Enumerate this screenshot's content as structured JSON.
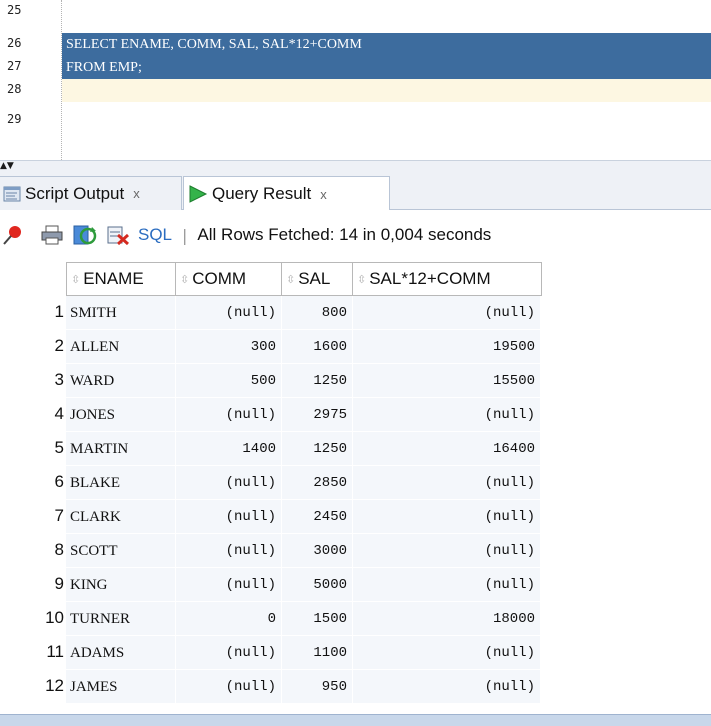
{
  "editor": {
    "lines": [
      {
        "num": "25",
        "code": "",
        "state": "normal"
      },
      {
        "num": "26",
        "code": "SELECT ENAME, COMM, SAL, SAL*12+COMM",
        "state": "selected"
      },
      {
        "num": "27",
        "code": "FROM EMP;",
        "state": "selected"
      },
      {
        "num": "28",
        "code": "",
        "state": "current"
      },
      {
        "num": "29",
        "code": "",
        "state": "normal"
      }
    ]
  },
  "tabs": {
    "script_output": {
      "label": "Script Output",
      "close": "x"
    },
    "query_result": {
      "label": "Query Result",
      "close": "x"
    }
  },
  "toolbar": {
    "icons": [
      "pin-icon",
      "print-icon",
      "refresh-icon",
      "sql-icon"
    ],
    "sql_label": "SQL",
    "separator": "|",
    "status": "All Rows Fetched: 14 in 0,004 seconds"
  },
  "grid": {
    "columns": [
      "ENAME",
      "COMM",
      "SAL",
      "SAL*12+COMM"
    ],
    "rows": [
      [
        "1",
        "SMITH",
        "(null)",
        "800",
        "(null)"
      ],
      [
        "2",
        "ALLEN",
        "300",
        "1600",
        "19500"
      ],
      [
        "3",
        "WARD",
        "500",
        "1250",
        "15500"
      ],
      [
        "4",
        "JONES",
        "(null)",
        "2975",
        "(null)"
      ],
      [
        "5",
        "MARTIN",
        "1400",
        "1250",
        "16400"
      ],
      [
        "6",
        "BLAKE",
        "(null)",
        "2850",
        "(null)"
      ],
      [
        "7",
        "CLARK",
        "(null)",
        "2450",
        "(null)"
      ],
      [
        "8",
        "SCOTT",
        "(null)",
        "3000",
        "(null)"
      ],
      [
        "9",
        "KING",
        "(null)",
        "5000",
        "(null)"
      ],
      [
        "10",
        "TURNER",
        "0",
        "1500",
        "18000"
      ],
      [
        "11",
        "ADAMS",
        "(null)",
        "1100",
        "(null)"
      ],
      [
        "12",
        "JAMES",
        "(null)",
        "950",
        "(null)"
      ]
    ]
  },
  "colors": {
    "selection": "#3d6c9e",
    "current_line": "#fdf7e2",
    "cell_bg": "#f4f7fb",
    "sql_link": "#2a6cc0"
  }
}
